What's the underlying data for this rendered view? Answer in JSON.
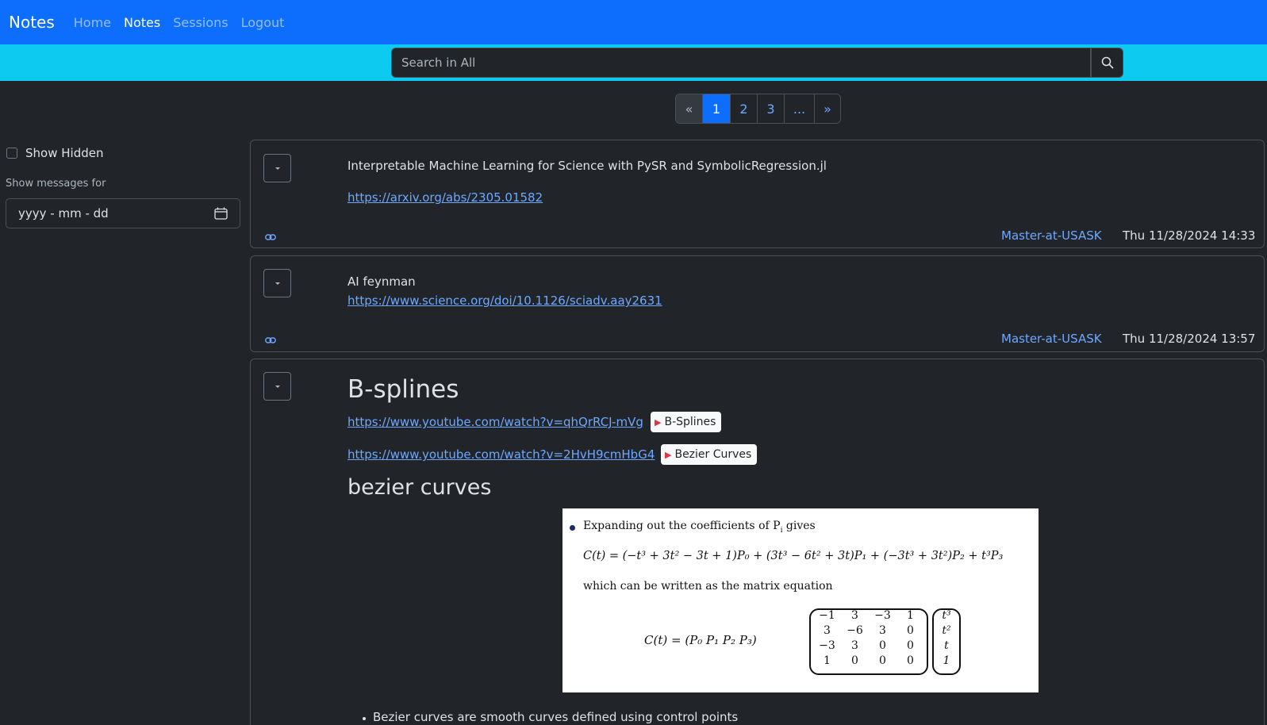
{
  "navbar": {
    "brand": "Notes",
    "links": [
      "Home",
      "Notes",
      "Sessions",
      "Logout"
    ],
    "active": "Notes",
    "color": "#0d6efd"
  },
  "search": {
    "placeholder": "Search in All",
    "bar_color": "#0dcaf0"
  },
  "pagination": {
    "prev": "«",
    "pages": [
      "1",
      "2",
      "3",
      "..."
    ],
    "next": "»",
    "current": "1"
  },
  "sidebar": {
    "show_hidden_label": "Show Hidden",
    "show_messages_label": "Show messages for",
    "date_placeholder": "yyyy - mm - dd"
  },
  "notes": [
    {
      "title": "Interpretable Machine Learning for Science with PySR and SymbolicRegression.jl",
      "link": "https://arxiv.org/abs/2305.01582",
      "author": "Master-at-USASK",
      "timestamp": "Thu 11/28/2024 14:33"
    },
    {
      "title": "AI feynman",
      "link": "https://www.science.org/doi/10.1126/sciadv.aay2631",
      "author": "Master-at-USASK",
      "timestamp": "Thu 11/28/2024 13:57"
    },
    {
      "heading": "B-splines",
      "links": [
        {
          "url": "https://www.youtube.com/watch?v=qhQrRCJ-mVg",
          "badge": "B-Splines"
        },
        {
          "url": "https://www.youtube.com/watch?v=2HvH9cmHbG4",
          "badge": "Bezier Curves"
        }
      ],
      "subheading": "bezier curves",
      "image": {
        "intro": "Expanding out the coefficients of P",
        "intro_sub": "i",
        "intro_end": " gives",
        "equation": "C(t) = (−t³ + 3t² − 3t + 1)P₀ + (3t³ − 6t² + 3t)P₁ + (−3t³ + 3t²)P₂ + t³P₃",
        "middle": "which can be written as the matrix equation",
        "lhs": "C(t) = (P₀   P₁   P₂   P₃)",
        "matrix": [
          "−1",
          "3",
          "−3",
          "1",
          "3",
          "−6",
          "3",
          "0",
          "−3",
          "3",
          "0",
          "0",
          "1",
          "0",
          "0",
          "0"
        ],
        "vector": [
          "t³",
          "t²",
          "t",
          "1"
        ]
      },
      "bullet": "Bezier curves are smooth curves defined using control points"
    }
  ]
}
